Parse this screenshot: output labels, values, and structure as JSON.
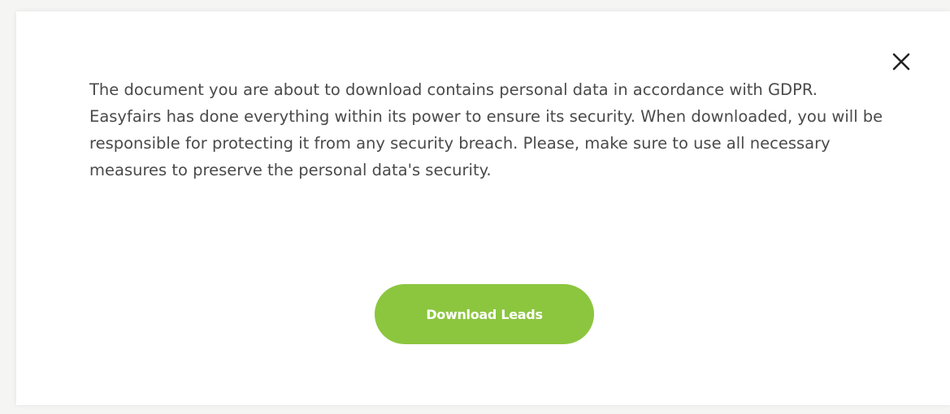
{
  "dialog": {
    "message": "The document you are about to download contains personal data in accordance with GDPR. Easyfairs has done everything within its power to ensure its security. When downloaded, you will be responsible for protecting it from any security breach. Please, make sure to use all necessary measures to preserve the personal data's security.",
    "primary_button_label": "Download Leads",
    "close_icon": "close-icon"
  },
  "colors": {
    "accent": "#8cc63f",
    "text": "#4a4a4a",
    "background": "#ffffff"
  }
}
